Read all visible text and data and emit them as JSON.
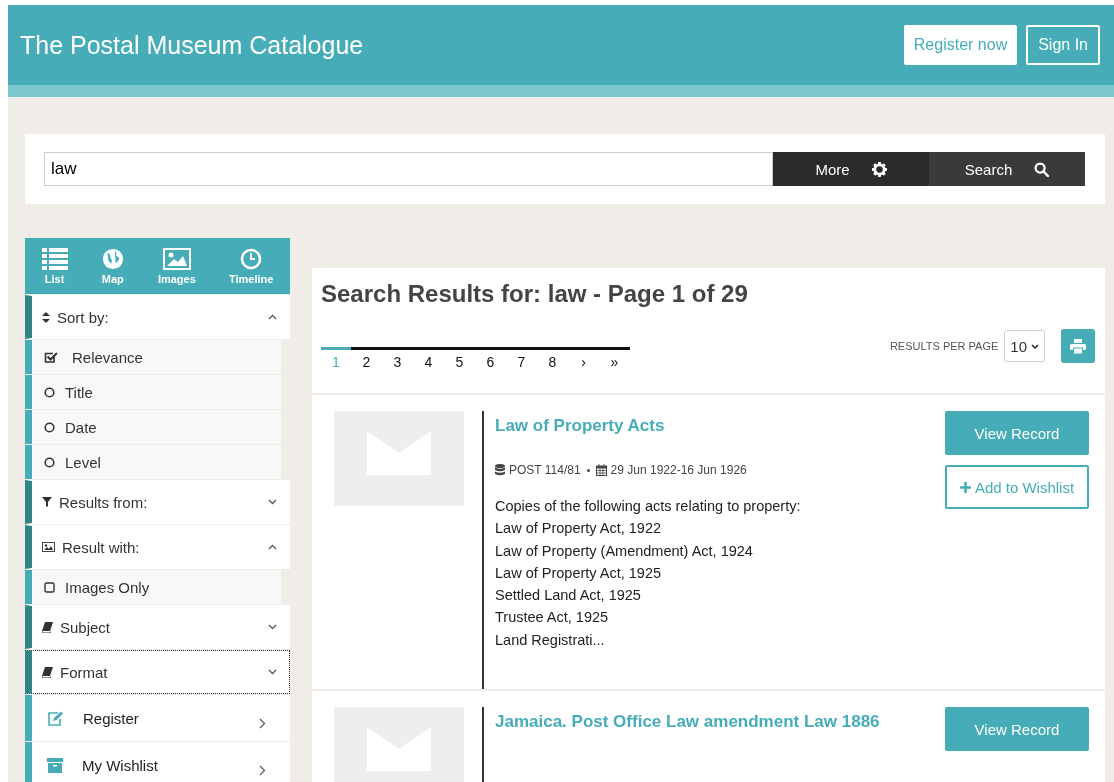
{
  "header": {
    "title": "The Postal Museum Catalogue",
    "buttons": [
      {
        "label": "Register now",
        "kind": "filled"
      },
      {
        "label": "Sign In",
        "kind": "outline"
      }
    ]
  },
  "search": {
    "value": "law",
    "buttons": [
      {
        "label": "More",
        "kind": "more"
      },
      {
        "label": "Search",
        "kind": "search"
      }
    ]
  },
  "view_modes": [
    {
      "label": "List"
    },
    {
      "label": "Map"
    },
    {
      "label": "Images"
    },
    {
      "label": "Timeline"
    }
  ],
  "sidebar": {
    "sections": [
      {
        "label": "Sort by:",
        "expanded": true,
        "focused": false,
        "options": [
          {
            "label": "Relevance",
            "selected": true
          },
          {
            "label": "Title",
            "selected": false
          },
          {
            "label": "Date",
            "selected": false
          },
          {
            "label": "Level",
            "selected": false
          }
        ]
      },
      {
        "label": "Results from:",
        "expanded": false,
        "focused": false
      },
      {
        "label": "Result with:",
        "expanded": true,
        "focused": false,
        "checkboxes": [
          {
            "label": "Images Only",
            "checked": false
          }
        ]
      },
      {
        "label": "Subject",
        "expanded": false,
        "focused": false
      },
      {
        "label": "Format",
        "expanded": false,
        "focused": true
      }
    ],
    "links": [
      {
        "label": "Register"
      },
      {
        "label": "My Wishlist"
      }
    ]
  },
  "results": {
    "heading": "Search Results for: law - Page 1 of 29",
    "pages": [
      {
        "label": "1",
        "selected": true
      },
      {
        "label": "2",
        "selected": false
      },
      {
        "label": "3",
        "selected": false
      },
      {
        "label": "4",
        "selected": false
      },
      {
        "label": "5",
        "selected": false
      },
      {
        "label": "6",
        "selected": false
      },
      {
        "label": "7",
        "selected": false
      },
      {
        "label": "8",
        "selected": false
      },
      {
        "label": "›",
        "selected": false
      },
      {
        "label": "»",
        "selected": false
      }
    ],
    "per_page_label": "RESULTS PER PAGE",
    "per_page": "10",
    "items": [
      {
        "title": "Law of Property Acts",
        "reference": "POST 114/81",
        "date": "29 Jun 1922-16 Jun 1926",
        "description": [
          "Copies of the following acts relating to property:",
          "Law of Property Act, 1922",
          "Law of Property (Amendment) Act, 1924",
          "Law of Property Act, 1925",
          "Settled Land Act, 1925",
          "Trustee Act, 1925",
          "Land Registrati..."
        ],
        "buttons": [
          "View Record",
          "Add to Wishlist"
        ]
      },
      {
        "title": "Jamaica. Post Office Law amendment Law 1886",
        "buttons": [
          "View Record"
        ]
      }
    ]
  }
}
